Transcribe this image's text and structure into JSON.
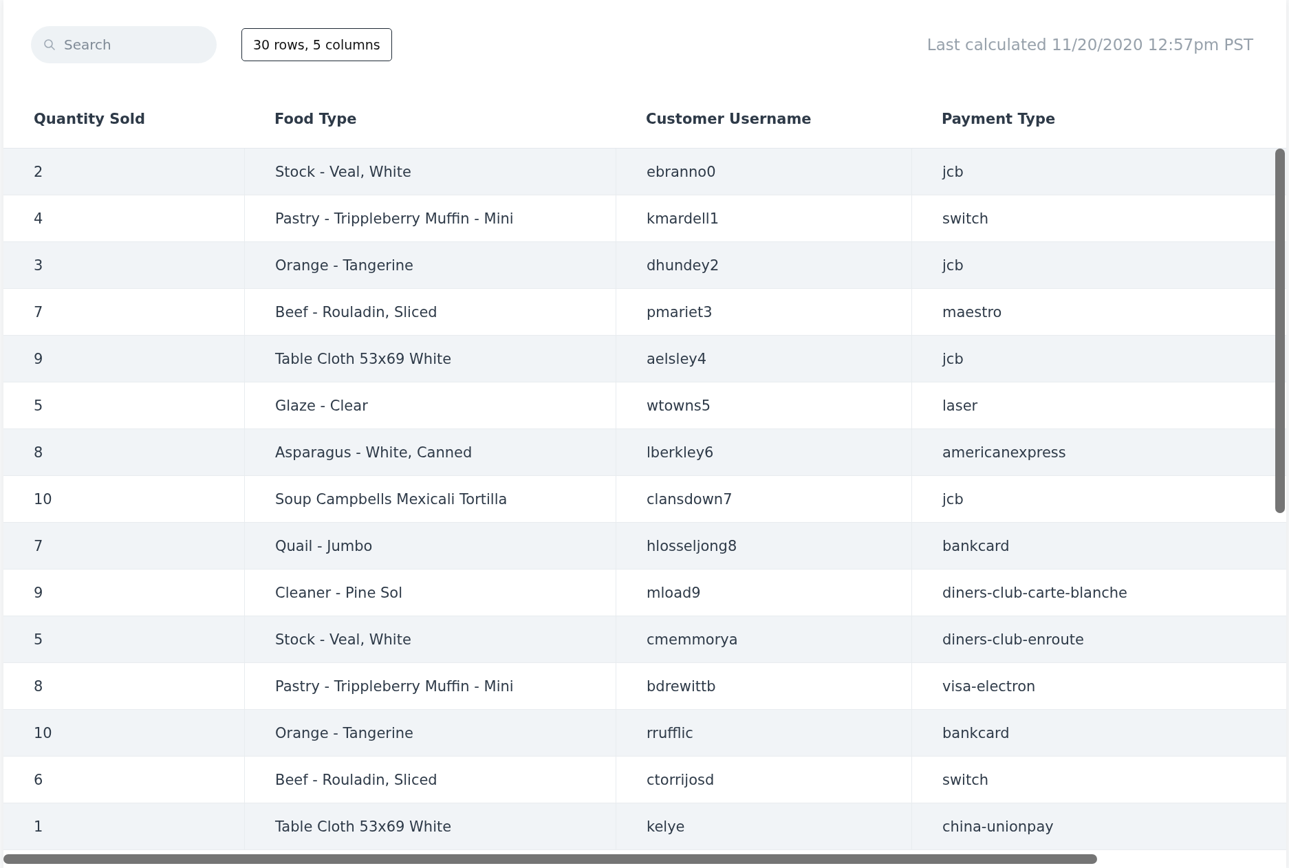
{
  "toolbar": {
    "search": {
      "placeholder": "Search"
    },
    "summary_badge": "30 rows, 5 columns",
    "last_calculated": "Last calculated 11/20/2020 12:57pm PST"
  },
  "table": {
    "columns": [
      "Quantity Sold",
      "Food Type",
      "Customer Username",
      "Payment Type"
    ],
    "rows": [
      [
        "2",
        "Stock - Veal, White",
        "ebranno0",
        "jcb"
      ],
      [
        "4",
        "Pastry - Trippleberry Muffin - Mini",
        "kmardell1",
        "switch"
      ],
      [
        "3",
        "Orange - Tangerine",
        "dhundey2",
        "jcb"
      ],
      [
        "7",
        "Beef - Rouladin, Sliced",
        "pmariet3",
        "maestro"
      ],
      [
        "9",
        "Table Cloth 53x69 White",
        "aelsley4",
        "jcb"
      ],
      [
        "5",
        "Glaze - Clear",
        "wtowns5",
        "laser"
      ],
      [
        "8",
        "Asparagus - White, Canned",
        "lberkley6",
        "americanexpress"
      ],
      [
        "10",
        "Soup Campbells Mexicali Tortilla",
        "clansdown7",
        "jcb"
      ],
      [
        "7",
        "Quail - Jumbo",
        "hlosseljong8",
        "bankcard"
      ],
      [
        "9",
        "Cleaner - Pine Sol",
        "mload9",
        "diners-club-carte-blanche"
      ],
      [
        "5",
        "Stock - Veal, White",
        "cmemmorya",
        "diners-club-enroute"
      ],
      [
        "8",
        "Pastry - Trippleberry Muffin - Mini",
        "bdrewittb",
        "visa-electron"
      ],
      [
        "10",
        "Orange - Tangerine",
        "rrufflic",
        "bankcard"
      ],
      [
        "6",
        "Beef - Rouladin, Sliced",
        "ctorrijosd",
        "switch"
      ],
      [
        "1",
        "Table Cloth 53x69 White",
        "kelye",
        "china-unionpay"
      ]
    ]
  }
}
